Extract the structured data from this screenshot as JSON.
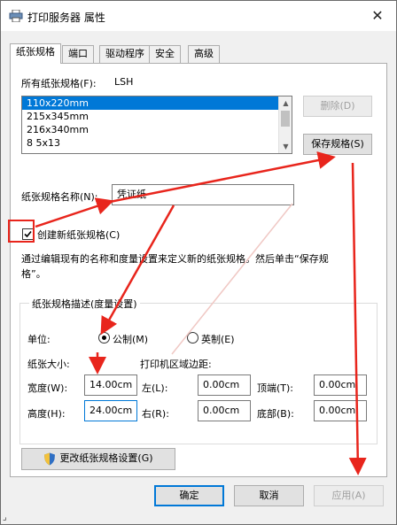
{
  "window": {
    "title": "打印服务器 属性",
    "close_glyph": "✕"
  },
  "tabs": [
    {
      "label": "纸张规格"
    },
    {
      "label": "端口"
    },
    {
      "label": "驱动程序"
    },
    {
      "label": "安全"
    },
    {
      "label": "高级"
    }
  ],
  "forms": {
    "all_forms_label": "所有纸张规格(F):",
    "server_name": "LSH",
    "items": [
      "110x220mm",
      "215x345mm",
      "216x340mm",
      "8 5x13"
    ],
    "delete_label": "删除(D)",
    "save_label": "保存规格(S)",
    "name_label": "纸张规格名称(N):",
    "name_value": "凭证纸",
    "create_label": "创建新纸张规格(C)",
    "description": "通过编辑现有的名称和度量设置来定义新的纸张规格。然后单击“保存规格”。"
  },
  "measure": {
    "group_title": "纸张规格描述(度量设置)",
    "unit_label": "单位:",
    "metric_label": "公制(M)",
    "english_label": "英制(E)",
    "paper_size_label": "纸张大小:",
    "margins_label": "打印机区域边距:",
    "width_label": "宽度(W):",
    "width_value": "14.00cm",
    "height_label": "高度(H):",
    "height_value": "24.00cm",
    "left_label": "左(L):",
    "left_value": "0.00cm",
    "right_label": "右(R):",
    "right_value": "0.00cm",
    "top_label": "顶端(T):",
    "top_value": "0.00cm",
    "bottom_label": "底部(B):",
    "bottom_value": "0.00cm"
  },
  "change_settings_label": "更改纸张规格设置(G)",
  "footer": {
    "ok_label": "确定",
    "cancel_label": "取消",
    "apply_label": "应用(A)"
  },
  "annotation_color": "#e8251c",
  "accent_color": "#0078d7"
}
